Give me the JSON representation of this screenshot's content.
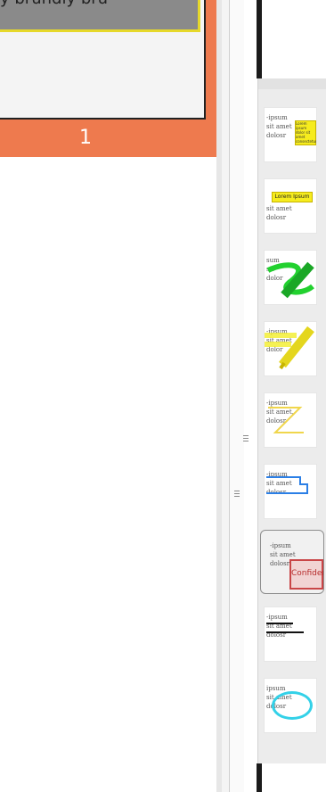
{
  "thumbnail": {
    "header_text": "y brundly bru",
    "page_number": "1"
  },
  "annotation_styles": [
    {
      "name": "sticky-note",
      "sample": "-ipsum\nsit amet\ndolosr",
      "note_text": "Lorem ipsum dolor sit amet consectetur"
    },
    {
      "name": "text-box",
      "sample": "sit amet\ndolosr",
      "box_text": "Lorem Ipsum"
    },
    {
      "name": "freehand-green",
      "sample": "sum\nsit\ndolor"
    },
    {
      "name": "highlighter",
      "sample": "-ipsum\nsit amet\ndolor"
    },
    {
      "name": "zigzag-line",
      "sample": "-ipsum\nsit amet,\ndolosr"
    },
    {
      "name": "callout",
      "sample": "-ipsum\nsit amet\ndolosr"
    },
    {
      "name": "stamp",
      "sample": "-ipsum\nsit amet\ndolosr",
      "stamp_text": "Confidential"
    },
    {
      "name": "underline",
      "sample": "-ipsum\nsit amet\ndolosr"
    },
    {
      "name": "circle",
      "sample": "ipsum\nsit amet\ndolosr"
    }
  ]
}
